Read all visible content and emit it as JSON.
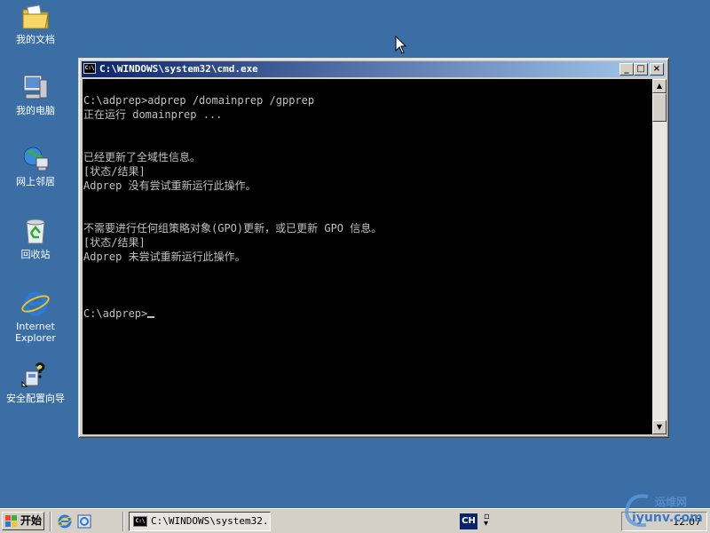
{
  "desktop": {
    "icons": [
      {
        "label": "我的文档",
        "icon": "folder-documents-icon"
      },
      {
        "label": "我的电脑",
        "icon": "computer-icon"
      },
      {
        "label": "网上邻居",
        "icon": "network-icon"
      },
      {
        "label": "回收站",
        "icon": "recycle-bin-icon"
      },
      {
        "label": "Internet\nExplorer",
        "icon": "internet-explorer-icon"
      },
      {
        "label": "安全配置向导",
        "icon": "security-wizard-icon"
      }
    ]
  },
  "window": {
    "icon_text": "C:\\",
    "title": "C:\\WINDOWS\\system32\\cmd.exe",
    "minimize": "_",
    "maximize": "□",
    "close": "×"
  },
  "console": {
    "lines": [
      "C:\\adprep>adprep /domainprep /gpprep",
      "正在运行 domainprep ...",
      "",
      "",
      "已经更新了全域性信息。",
      "[状态/结果]",
      "Adprep 没有尝试重新运行此操作。",
      "",
      "",
      "不需要进行任何组策略对象(GPO)更新，或已更新 GPO 信息。",
      "[状态/结果]",
      "Adprep 未尝试重新运行此操作。",
      "",
      "",
      "",
      ""
    ],
    "prompt": "C:\\adprep>"
  },
  "scrollbar": {
    "up": "▲",
    "down": "▼"
  },
  "taskbar": {
    "start_label": "开始",
    "task_icon_text": "C:\\",
    "task_cmd_label": "C:\\WINDOWS\\system32...",
    "lang": "CH",
    "clock": "12:07"
  },
  "watermark": {
    "cn": "运维网",
    "en": "iyunv.com"
  },
  "colors": {
    "desktop": "#3a6ea5",
    "titlebar_start": "#0a246a",
    "titlebar_end": "#a6caf0",
    "console_bg": "#000000",
    "console_fg": "#c0c0c0",
    "chrome": "#d4d0c8"
  }
}
